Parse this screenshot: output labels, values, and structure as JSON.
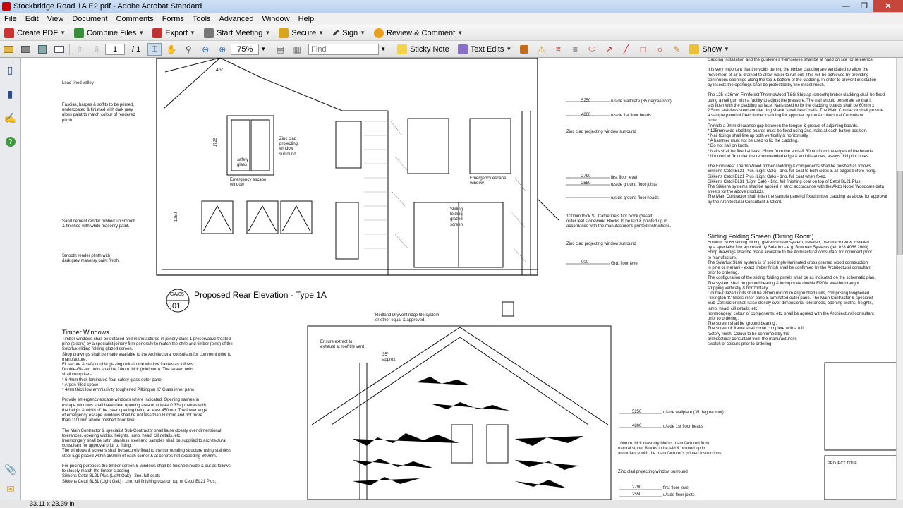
{
  "window": {
    "title": "Stockbridge Road 1A E2.pdf - Adobe Acrobat Standard",
    "min": "—",
    "max": "❐",
    "close": "✕"
  },
  "menu": [
    "File",
    "Edit",
    "View",
    "Document",
    "Comments",
    "Forms",
    "Tools",
    "Advanced",
    "Window",
    "Help"
  ],
  "tasks": {
    "create_pdf": "Create PDF",
    "combine": "Combine Files",
    "export": "Export",
    "meeting": "Start Meeting",
    "secure": "Secure",
    "sign": "Sign",
    "review": "Review & Comment"
  },
  "toolbar": {
    "page_current": "1",
    "page_total": "/ 1",
    "zoom": "75%",
    "find_placeholder": "Find",
    "sticky_note": "Sticky Note",
    "text_edits": "Text Edits",
    "show": "Show"
  },
  "status": {
    "page_size": "33.11 x 23.39 in"
  },
  "drawing": {
    "top_notes": {
      "lead": "Lead lined valley",
      "fascia": "Fascias, barges & soffits to be primed,\nundercoated & finished with dark grey\ngloss paint to match colour of rendered\nplinth.",
      "sand": "Sand cement render rubbed up smooth\n& finished with white masonry paint.",
      "smooth": "Smooth render plinth with\ndark grey masonry paint finish.",
      "zinc_clad": "Zinc clad\nprojecting\nwindow\nsurround",
      "escape": "Emergency escape\nwindow",
      "escape2": "Emergency escape\nwindow",
      "sliding": "Sliding\nfolding\nglazed\nscreen",
      "safety": "safety\nglass",
      "dim_1725": "1725",
      "dim_1060": "1060",
      "angle": "45°"
    },
    "levels_top": [
      {
        "val": "5250",
        "label": "u/side wallplate (35 degree roof)"
      },
      {
        "val": "4800",
        "label": "u/side 1st floor heads"
      },
      {
        "val": "",
        "label": "Zinc clad projecting window surround"
      },
      {
        "val": "2790",
        "label": "first floor level"
      },
      {
        "val": "2550",
        "label": "u/side ground floor joists"
      },
      {
        "val": "",
        "label": "u/side ground floor heads"
      },
      {
        "val": "",
        "label": "100mm thick St. Catherine's flint block (basalt)\nouter leaf stonework. Blocks to be laid & pointed up in\naccordance with the manufacturer's printed instructions."
      },
      {
        "val": "",
        "label": "Zinc clad projecting window surround"
      },
      {
        "val": "000",
        "label": "Grd. floor level"
      }
    ],
    "section_title": {
      "ref": "GA/05",
      "num": "01",
      "title": "Proposed Rear Elevation - Type 1A"
    },
    "timber_heading": "Timber Windows",
    "timber_text": "Timber windows shall be detailed and manufactured in joinery class 1 preservative treated\npine (clears) by a specialist joinery firm generally to match the style and timber (pine) of the\nSolarlux sliding folding glazed screen.\nShop drawings shall be made available to the Architectural consultant for comment prior to\nmanufacture.\nFit secure & safe double glazing units in the window frames as follows:\nDouble-Glazed units shall be 28mm thick (minimum). The sealed units\nshall comprise -\n* 6.4mm thick laminated float safety glass outer pane.\n* Argon filled space\n* 4mm thick low emmissivity toughened Pilkington 'K' Glass inner pane.\n\nProvide emergency escape windows where indicated. Opening sashes in\nescape windows shall have clear opening area of at least 0.33sq metres with\nthe height & width of the clear opening being at least 450mm. The lower edge\nof emergency escape windows shall be not less than 800mm and not more\nthan 1100mm above finished floor level.\n\nThe Main Contractor & specialist Sub-Contractor shall liaise closely over dimensional\ntolerances, opening widths, heights, jamb, head, cill details, etc.\nIronmongery shall be satin stainless steel and samples shall be supplied to architectural\nconsultant for approval prior to fitting.\nThe windows & screens shall be securely fixed to the surrounding structure using stainless\nsteel lugs placed within 150mm of each corner & at centres not exceeding 600mm.\n\nFor pricing purposes the timber screen & windows shall be finished inside & out as follows\nto closely match the timber cladding\nSikkens Cetol BL21 Plus (Light Oak) - 2no. full coats\nSikkens Cetol BL31 (Light Oak) - 1no. full finishing coat on top of Cetol BL21 Plus.",
    "lower_notes": {
      "ridge": "Redland DryVent ridge tile system\nor other equal & approved.",
      "extract": "Ensure extract to\nexhaust at roof tile vent",
      "approx": "35°\napprox.",
      "stone": "100mm thick masonry blocks manufactured from\nnatural stone. Blocks to be laid & pointed up in\naccordance with the manufacturer's printed instructions.",
      "zinc_lower": "Zinc clad projecting window surround"
    },
    "levels_bottom": [
      {
        "val": "5250",
        "label": "u/side wallplate (35 degree roof)"
      },
      {
        "val": "4800",
        "label": "u/side 1st floor heads"
      },
      {
        "val": "2790",
        "label": "first floor level"
      },
      {
        "val": "2550",
        "label": "u/side floor joists"
      }
    ],
    "right_text": "cladding installation and the guidelines themselves shall be at hand on site for reference.\n\nIt is very important that the voids behind the timber cladding are ventilated to allow the\nmovement of air & drained to allow water to run out. This will be achieved by providing\ncontinuous openings along the top & bottom of the cladding. In order to prevent infestation\nby insects the openings shall be protected by fine insect mesh.\n\nThe 125 x 26mm Finnforest ThermoWood T&G Shiplap (smooth) timber cladding shall be fixed\nusing a nail gun with a facility to adjust the pressure. The nail should penetrate so that it\nsits flush with the cladding surface. Nails used to fix the cladding boards shall be 60mm x\n2.5mm stainless steel annular ring shank 'small head' nails. The Main Contractor shall provide\na sample panel of fixed timber cladding for approval by the Architectural Consultant.\nNote:\nProvide a 2mm clearance gap between the tongue & groove of adjoining boards.\n* 125mm wide cladding boards must be fixed using 2no. nails at each batten position.\n* Nail fixings shall line up both vertically & horizontally.\n* A hammer must not be used to fix the cladding.\n* Do not nail on knots.\n* Nails shall be fixed at least 25mm from the ends & 30mm from the edges of the boards.\n* If forced to fix under the recommended edge & end distances, always drill pilot holes.\n\nThe Finnforest ThermoWood timber cladding & components shall be finished as follows\nSikkens Cetol BL21 Plus (Light Oak) - 1no. full coat to both sides & all edges before fixing.\nSikkens Cetol BL21 Plus (Light Oak) - 1no. full coat when fixed.\nSikkens Cetol BL31 (Light Oak) - 1no. full finishing coat on top of Cetol BL21 Plus.\nThe Sikkens systems shall be applied in strict accordance with the Akzo Nobel Woodcare data\nsheets for the above products.\nThe Main Contractor shall finish the sample panel of fixed timber cladding as above for approval\nby the Architectural Consultant & Client.",
    "sliding_heading": "Sliding Folding Screen (Dining Room).",
    "sliding_text": "Solarlux SL66 sliding folding glazed screen system, detailed, manufactured & installed\nby a specialist firm approved by Solarlux - e.g. Bowman Systems (tel. 028 4066 2000).\nShop drawings shall be made available to the Architectural consultant for comment prior\nto manufacture.\nThe Solarlux SL66 system is of solid triple-laminated cross grained wood construction\nin pine or meranti - exact timber finish shall be confirmed by the Architectural consultant\nprior to ordering.\nThe configuration of the sliding folding panels shall be as indicated on the schematic plan.\nThe system shall be ground bearing & incorporate double EPDM weatherdraught\nstripping vertically & horizontally.\nDouble-Glazed units shall be 28mm minimum Argon filled units, comprising toughened\nPilkington 'K' Glass inner pane & laminated outer pane. The Main Contractor & specialist\nSub-Contractor shall liaise closely over dimensional tolerances, opening widths, heights,\njamb, head, cill details, etc.\nIronmongery, colour of components, etc. shall be agreed with the Architectural consultant\nprior to ordering.\nThe screen shall be 'ground bearing'.\nThe screen & frame shall come complete with a full\nfactory finish. Colour to be confirmed by the\narchitectural consultant from the manufacturer's\nswatch of colours prior to ordering.",
    "project_title": "PROJECT TITLE"
  }
}
